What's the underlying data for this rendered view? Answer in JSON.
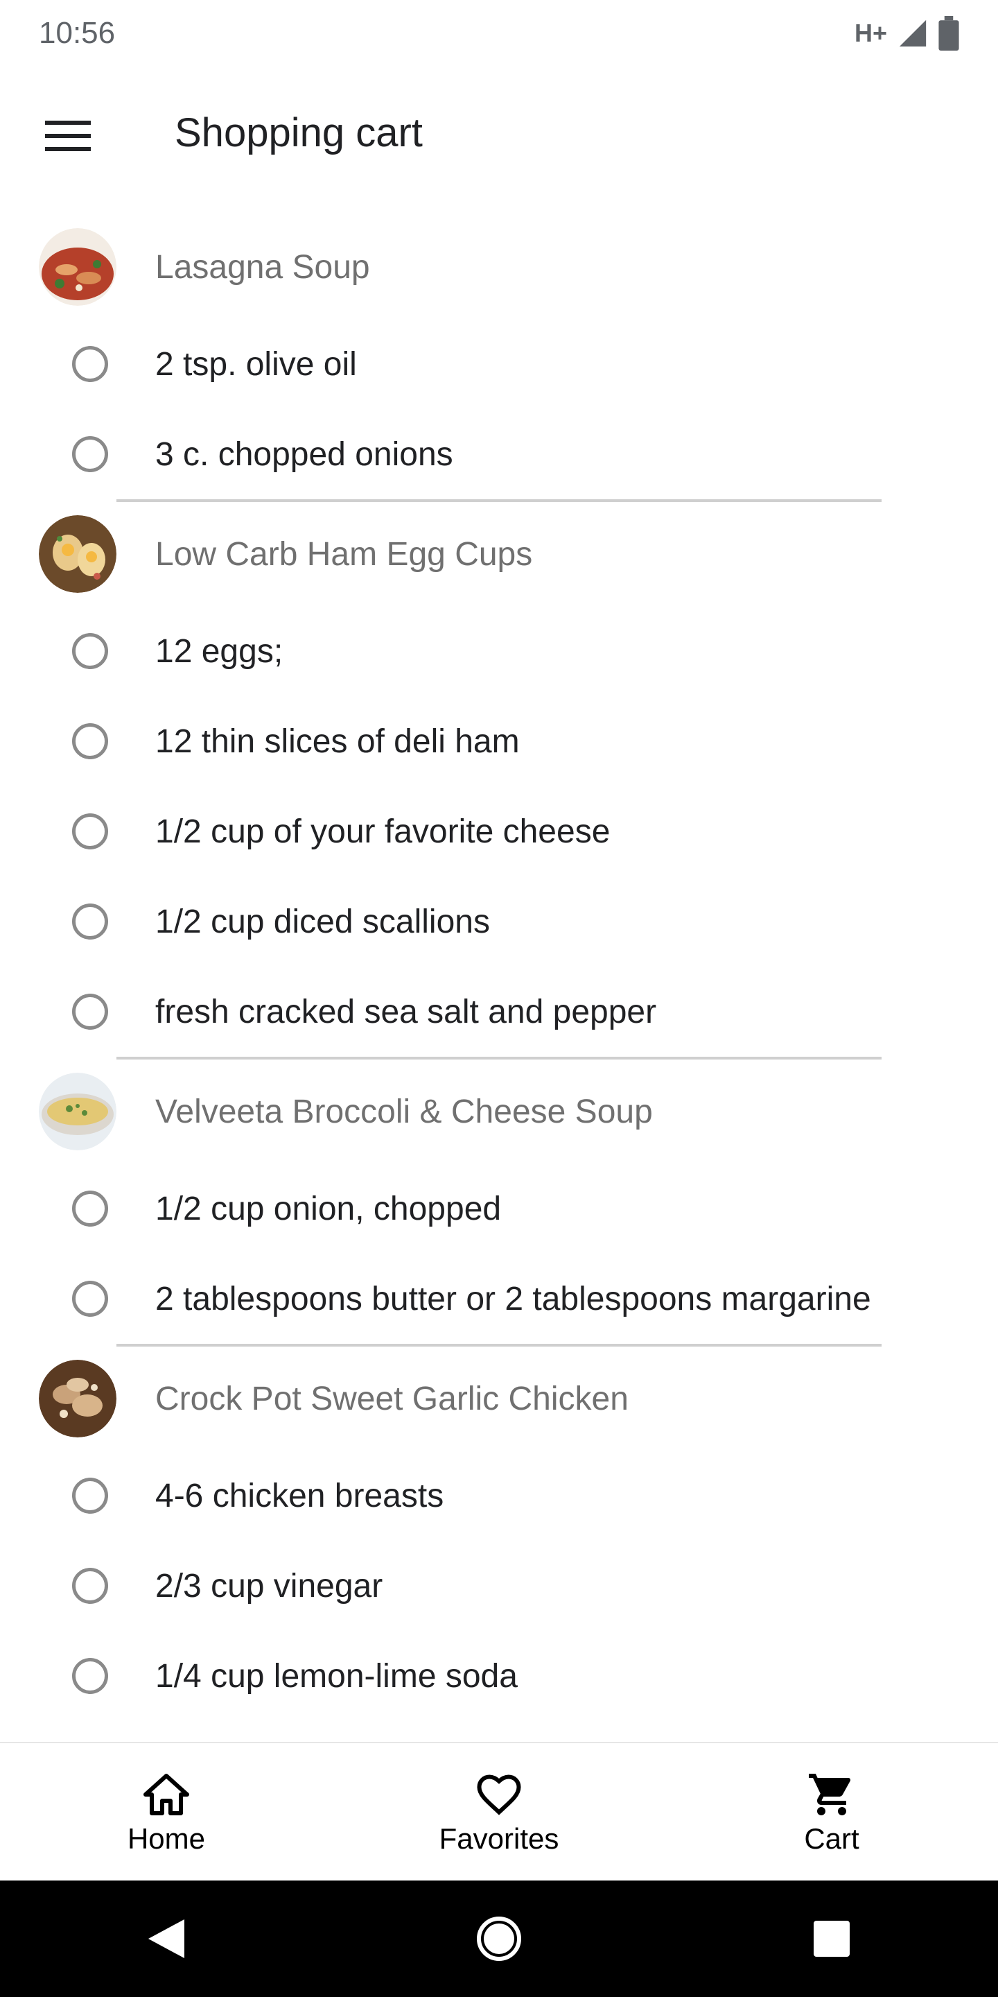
{
  "status_bar": {
    "time": "10:56",
    "network": "H+"
  },
  "app_bar": {
    "title": "Shopping cart"
  },
  "recipes": [
    {
      "title": "Lasagna Soup",
      "ingredients": [
        "2 tsp. olive oil",
        "3 c. chopped onions"
      ]
    },
    {
      "title": "Low Carb Ham Egg Cups",
      "ingredients": [
        "12 eggs;",
        "12 thin slices of deli ham",
        "1/2 cup of your favorite cheese",
        "1/2 cup diced scallions",
        "fresh cracked sea salt and pepper"
      ]
    },
    {
      "title": "Velveeta Broccoli & Cheese Soup",
      "ingredients": [
        "1/2 cup onion, chopped",
        "2 tablespoons butter or 2 tablespoons margarine"
      ]
    },
    {
      "title": "Crock Pot Sweet Garlic Chicken",
      "ingredients": [
        "4-6 chicken breasts",
        "2/3 cup vinegar",
        "1/4 cup lemon-lime soda"
      ]
    }
  ],
  "bottom_nav": {
    "home": "Home",
    "favorites": "Favorites",
    "cart": "Cart"
  },
  "icons": {
    "menu": "menu-icon",
    "home": "home-icon",
    "favorites": "heart-icon",
    "cart": "cart-icon",
    "back": "back-icon",
    "system_home": "circle-home-icon",
    "recents": "recents-icon"
  }
}
